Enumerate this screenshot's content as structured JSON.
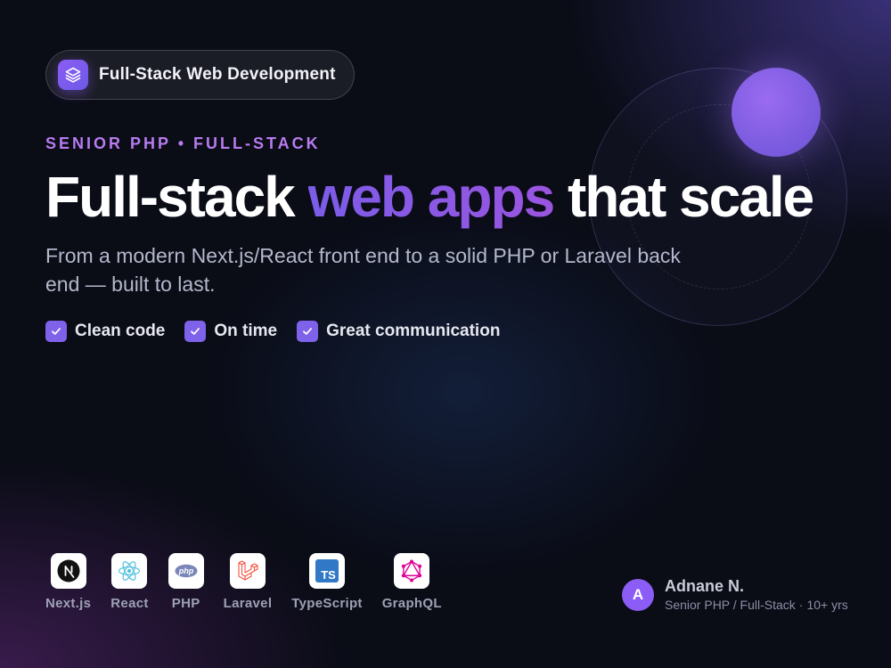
{
  "badge": {
    "label": "Full-Stack Web Development",
    "icon": "layers-icon"
  },
  "eyebrow": "SENIOR PHP • FULL-STACK",
  "headline": {
    "part1": "Full-stack ",
    "accent": "web apps",
    "part2": " that scale"
  },
  "subtitle": "From a modern Next.js/React front end to a solid PHP or Laravel back end — built to last.",
  "features": [
    {
      "label": "Clean code",
      "icon": "check-icon"
    },
    {
      "label": "On time",
      "icon": "check-icon"
    },
    {
      "label": "Great communication",
      "icon": "check-icon"
    }
  ],
  "tech": [
    {
      "label": "Next.js",
      "icon": "nextjs-icon"
    },
    {
      "label": "React",
      "icon": "react-icon"
    },
    {
      "label": "PHP",
      "icon": "php-icon"
    },
    {
      "label": "Laravel",
      "icon": "laravel-icon"
    },
    {
      "label": "TypeScript",
      "icon": "typescript-icon"
    },
    {
      "label": "GraphQL",
      "icon": "graphql-icon"
    }
  ],
  "author": {
    "initial": "A",
    "name": "Adnane N.",
    "role": "Senior PHP / Full-Stack",
    "separator": "·",
    "experience": "10+ yrs"
  },
  "colors": {
    "accent": "#8b5cf6",
    "eyebrow": "#b77cf0",
    "background": "#0a0c16"
  }
}
